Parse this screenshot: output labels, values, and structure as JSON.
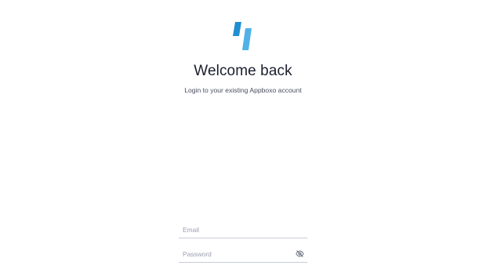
{
  "brand": {
    "logo_icon": "appboxo-logo-icon",
    "primary_color": "#1f8fd1",
    "secondary_color": "#5bb8ea"
  },
  "header": {
    "title": "Welcome back",
    "subtitle": "Login to your existing Appboxo account"
  },
  "login_form": {
    "email": {
      "placeholder": "Email",
      "value": ""
    },
    "password": {
      "placeholder": "Password",
      "value": "",
      "visibility_icon": "eye-off-icon"
    }
  }
}
